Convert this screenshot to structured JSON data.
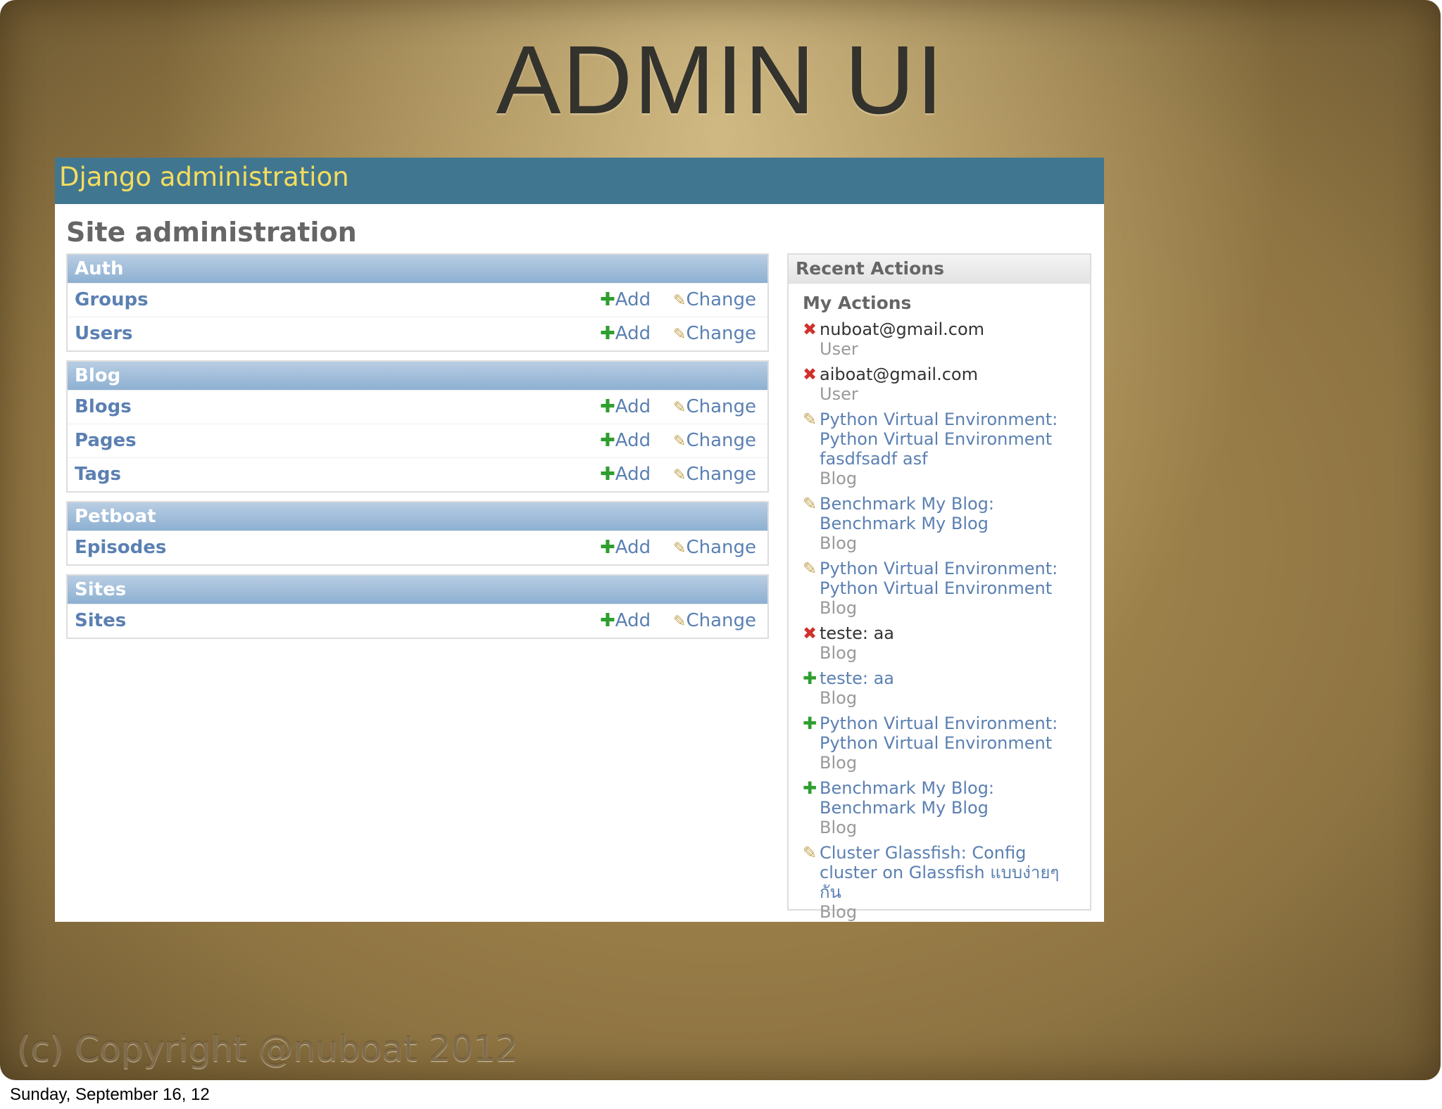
{
  "slide": {
    "title": "ADMIN UI",
    "copyright": "(c) Copyright @nuboat 2012",
    "date": "Sunday, September 16, 12"
  },
  "admin": {
    "header_title": "Django administration",
    "site_title": "Site administration",
    "add_label": "Add",
    "change_label": "Change",
    "modules": [
      {
        "caption": "Auth",
        "rows": [
          "Groups",
          "Users"
        ]
      },
      {
        "caption": "Blog",
        "rows": [
          "Blogs",
          "Pages",
          "Tags"
        ]
      },
      {
        "caption": "Petboat",
        "rows": [
          "Episodes"
        ]
      },
      {
        "caption": "Sites",
        "rows": [
          "Sites"
        ]
      }
    ],
    "recent": {
      "caption": "Recent Actions",
      "my_actions": "My Actions",
      "actions": [
        {
          "icon": "delete",
          "lines": [
            "nuboat@gmail.com"
          ],
          "type": "User"
        },
        {
          "icon": "delete",
          "lines": [
            "aiboat@gmail.com"
          ],
          "type": "User"
        },
        {
          "icon": "change",
          "lines": [
            "Python Virtual Environment:",
            "Python Virtual Environment",
            "fasdfsadf asf"
          ],
          "type": "Blog"
        },
        {
          "icon": "change",
          "lines": [
            "Benchmark My Blog:",
            "Benchmark My Blog"
          ],
          "type": "Blog"
        },
        {
          "icon": "change",
          "lines": [
            "Python Virtual Environment:",
            "Python Virtual Environment"
          ],
          "type": "Blog"
        },
        {
          "icon": "delete",
          "lines": [
            "teste: aa"
          ],
          "type": "Blog"
        },
        {
          "icon": "add",
          "lines": [
            "teste: aa"
          ],
          "type": "Blog"
        },
        {
          "icon": "add",
          "lines": [
            "Python Virtual Environment:",
            "Python Virtual Environment"
          ],
          "type": "Blog"
        },
        {
          "icon": "add",
          "lines": [
            "Benchmark My Blog:",
            "Benchmark My Blog"
          ],
          "type": "Blog"
        },
        {
          "icon": "change",
          "lines": [
            "Cluster Glassfish: Config",
            "cluster on Glassfish แบบง่ายๆ",
            "กัน"
          ],
          "type": "Blog"
        }
      ]
    }
  }
}
